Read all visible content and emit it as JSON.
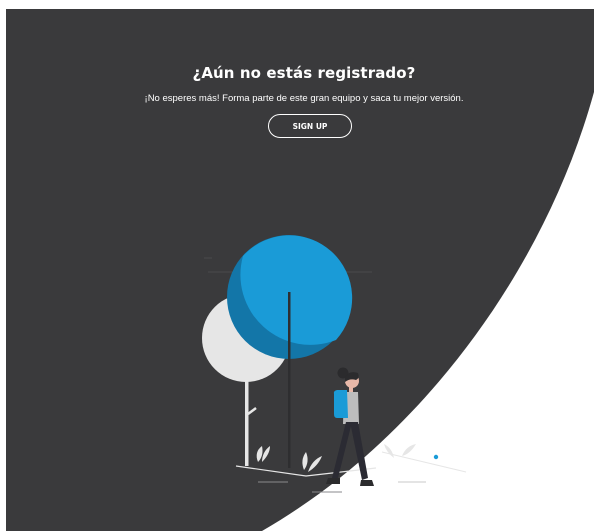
{
  "colors": {
    "dark_background": "#3a3a3c",
    "light_background": "#ffffff",
    "accent_blue": "#1a9bd7",
    "accent_blue_dark": "#1376a8",
    "tree_light": "#e6e6e6"
  },
  "cta": {
    "title": "¿Aún no estás registrado?",
    "subtitle": "¡No esperes más! Forma parte de este gran equipo y saca tu mejor versión.",
    "button_label": "SIGN UP"
  },
  "illustration": {
    "icon": "person-walking-with-backpack-among-trees-illustration"
  }
}
